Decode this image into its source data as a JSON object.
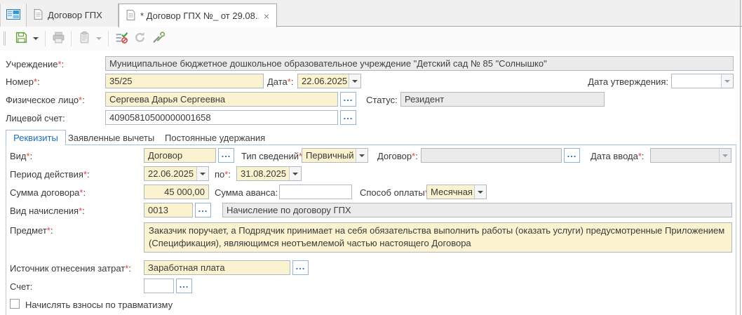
{
  "marks": {
    "star": "*",
    "colon": ":"
  },
  "icons": {
    "ellipsis": "...",
    "close": "×",
    "workspace": "workspace-panel-icon",
    "document": "document-icon",
    "save": "save-icon",
    "save_menu": "save-menu-arrow-icon",
    "print": "print-icon",
    "copy": "copy-icon",
    "copy_menu": "copy-menu-arrow-icon",
    "check": "check-document-icon",
    "refresh": "refresh-icon",
    "tools": "tools-icon",
    "dropdown": "dropdown-arrow-icon"
  },
  "window_tabs": {
    "items": [
      {
        "label": "Договор ГПХ"
      },
      {
        "label": "* Договор ГПХ №_ от 29.08...."
      }
    ]
  },
  "header_fields": {
    "institution": {
      "label": "Учреждение",
      "value": "Муниципальное бюджетное дошкольное образовательное учреждение \"Детский сад № 85 \"Солнышко\""
    },
    "number": {
      "label": "Номер",
      "value": "35/25"
    },
    "doc_date": {
      "label": "Дата",
      "value": "22.06.2025"
    },
    "approve_date": {
      "label": "Дата утверждения",
      "value": ""
    },
    "person": {
      "label": "Физическое лицо",
      "value": "Сергеева Дарья Сергеевна"
    },
    "status": {
      "label": "Статус",
      "value": "Резидент"
    },
    "personal_account": {
      "label": "Лицевой счет",
      "value": "40905810500000001658"
    }
  },
  "section_tabs": [
    {
      "label": "Реквизиты"
    },
    {
      "label": "Заявленные вычеты"
    },
    {
      "label": "Постоянные удержания"
    }
  ],
  "details": {
    "kind": {
      "label": "Вид",
      "value": "Договор"
    },
    "info_type": {
      "label": "Тип сведений",
      "value": "Первичный"
    },
    "base_contract": {
      "label": "Договор",
      "value": ""
    },
    "entry_date": {
      "label": "Дата ввода",
      "value": ""
    },
    "period": {
      "label": "Период действия",
      "from": "22.06.2025",
      "to_label": "по",
      "to": "31.08.2025"
    },
    "total": {
      "label": "Сумма договора",
      "value": "45 000,00"
    },
    "advance": {
      "label": "Сумма аванса",
      "value": ""
    },
    "payment_method": {
      "label": "Способ оплаты",
      "value": "Месячная"
    },
    "accrual": {
      "label": "Вид начисления",
      "code": "0013",
      "description": "Начисление по договору ГПХ"
    },
    "subject": {
      "label": "Предмет",
      "value": "Заказчик поручает, а Подрядчик принимает на себя обязательства выполнить работы (оказать услуги) предусмотренные Приложением (Спецификация), являющимся неотъемлемой частью настоящего Договора"
    },
    "cost_source": {
      "label": "Источник отнесения затрат",
      "value": "Заработная плата"
    },
    "account": {
      "label": "Счет",
      "value": ""
    },
    "injury_checkbox": {
      "label": "Начислять взносы по травматизму",
      "checked": false
    }
  },
  "colors": {
    "field_yellow": "#fbf2cf",
    "field_readonly": "#ebebeb",
    "section_tab_active": "#1c6fbd",
    "required": "#e0443f"
  }
}
